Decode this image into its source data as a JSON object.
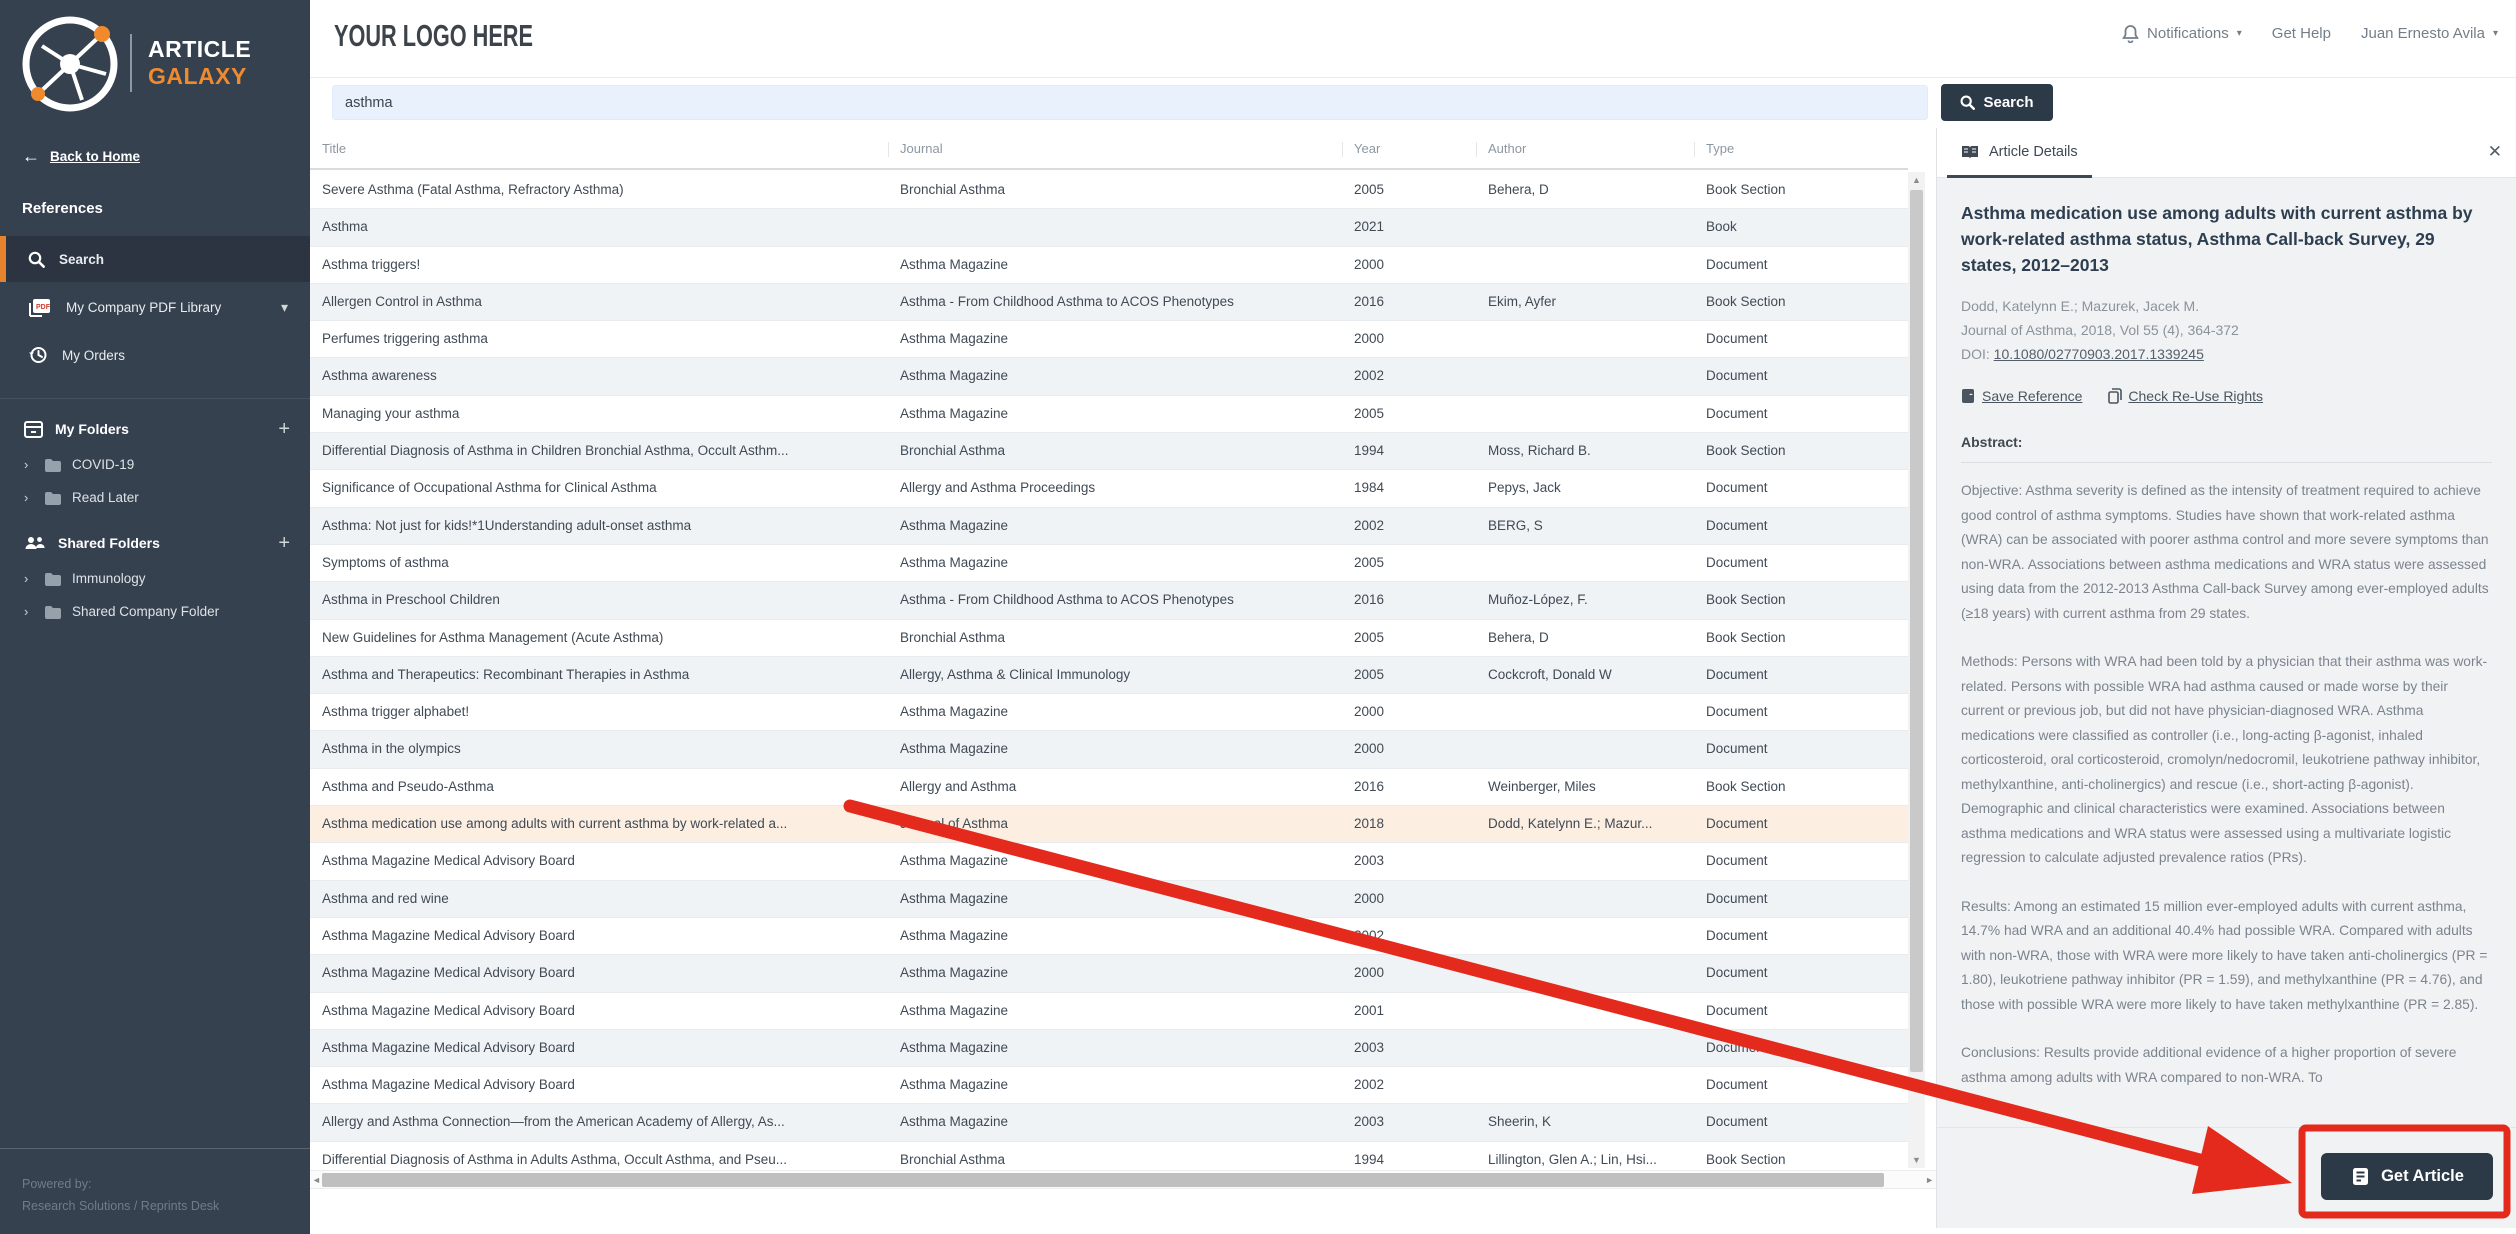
{
  "icons": {
    "chevron_right": "›",
    "caret_down": "▾",
    "plus": "+",
    "back_arrow": "←",
    "close": "✕",
    "up": "▲",
    "down": "▼",
    "left": "◄",
    "right": "►"
  },
  "app": {
    "brand_line1": "ARTICLE",
    "brand_line2": "GALAXY",
    "customer_logo": "YOUR LOGO HERE",
    "powered_by_label": "Powered by:",
    "powered_by_value": "Research Solutions / Reprints Desk"
  },
  "header": {
    "notifications_label": "Notifications",
    "get_help_label": "Get Help",
    "user_name": "Juan Ernesto Avila"
  },
  "search": {
    "query": "asthma",
    "button_label": "Search"
  },
  "sidebar": {
    "back_to_home": "Back to Home",
    "section_references": "References",
    "items": [
      {
        "label": "Search"
      },
      {
        "label": "My Company PDF Library"
      },
      {
        "label": "My Orders"
      }
    ],
    "my_folders_label": "My Folders",
    "my_folders": [
      "COVID-19",
      "Read Later"
    ],
    "shared_folders_label": "Shared Folders",
    "shared_folders": [
      "Immunology",
      "Shared Company Folder"
    ]
  },
  "table": {
    "columns": [
      "Title",
      "Journal",
      "Year",
      "Author",
      "Type"
    ],
    "rows": [
      {
        "title": "Severe Asthma (Fatal Asthma, Refractory Asthma)",
        "journal": "Bronchial Asthma",
        "year": "2005",
        "author": "Behera, D",
        "type": "Book Section"
      },
      {
        "title": "Asthma",
        "journal": "",
        "year": "2021",
        "author": "",
        "type": "Book"
      },
      {
        "title": "Asthma triggers!",
        "journal": "Asthma Magazine",
        "year": "2000",
        "author": "",
        "type": "Document"
      },
      {
        "title": "Allergen Control in Asthma",
        "journal": "Asthma - From Childhood Asthma to ACOS Phenotypes",
        "year": "2016",
        "author": "Ekim, Ayfer",
        "type": "Book Section"
      },
      {
        "title": "Perfumes triggering asthma",
        "journal": "Asthma Magazine",
        "year": "2000",
        "author": "",
        "type": "Document"
      },
      {
        "title": "Asthma awareness",
        "journal": "Asthma Magazine",
        "year": "2002",
        "author": "",
        "type": "Document"
      },
      {
        "title": "Managing your asthma",
        "journal": "Asthma Magazine",
        "year": "2005",
        "author": "",
        "type": "Document"
      },
      {
        "title": "Differential Diagnosis of Asthma in Children Bronchial Asthma, Occult Asthm...",
        "journal": "Bronchial Asthma",
        "year": "1994",
        "author": "Moss, Richard B.",
        "type": "Book Section"
      },
      {
        "title": "Significance of Occupational Asthma for Clinical Asthma",
        "journal": "Allergy and Asthma Proceedings",
        "year": "1984",
        "author": "Pepys, Jack",
        "type": "Document"
      },
      {
        "title": "Asthma: Not just for kids!*1Understanding adult-onset asthma",
        "journal": "Asthma Magazine",
        "year": "2002",
        "author": "BERG, S",
        "type": "Document"
      },
      {
        "title": "Symptoms of asthma",
        "journal": "Asthma Magazine",
        "year": "2005",
        "author": "",
        "type": "Document"
      },
      {
        "title": "Asthma in Preschool Children",
        "journal": "Asthma - From Childhood Asthma to ACOS Phenotypes",
        "year": "2016",
        "author": "Muñoz-López, F.",
        "type": "Book Section"
      },
      {
        "title": "New Guidelines for Asthma Management (Acute Asthma)",
        "journal": "Bronchial Asthma",
        "year": "2005",
        "author": "Behera, D",
        "type": "Book Section"
      },
      {
        "title": "Asthma and Therapeutics: Recombinant Therapies in Asthma",
        "journal": "Allergy, Asthma & Clinical Immunology",
        "year": "2005",
        "author": "Cockcroft, Donald W",
        "type": "Document"
      },
      {
        "title": "Asthma trigger alphabet!",
        "journal": "Asthma Magazine",
        "year": "2000",
        "author": "",
        "type": "Document"
      },
      {
        "title": "Asthma in the olympics",
        "journal": "Asthma Magazine",
        "year": "2000",
        "author": "",
        "type": "Document"
      },
      {
        "title": "Asthma and Pseudo-Asthma",
        "journal": "Allergy and Asthma",
        "year": "2016",
        "author": "Weinberger, Miles",
        "type": "Book Section"
      },
      {
        "title": "Asthma medication use among adults with current asthma by work-related a...",
        "journal": "Journal of Asthma",
        "year": "2018",
        "author": "Dodd, Katelynn E.; Mazur...",
        "type": "Document",
        "selected": true
      },
      {
        "title": "Asthma Magazine Medical Advisory Board",
        "journal": "Asthma Magazine",
        "year": "2003",
        "author": "",
        "type": "Document"
      },
      {
        "title": "Asthma and red wine",
        "journal": "Asthma Magazine",
        "year": "2000",
        "author": "",
        "type": "Document"
      },
      {
        "title": "Asthma Magazine Medical Advisory Board",
        "journal": "Asthma Magazine",
        "year": "2002",
        "author": "",
        "type": "Document"
      },
      {
        "title": "Asthma Magazine Medical Advisory Board",
        "journal": "Asthma Magazine",
        "year": "2000",
        "author": "",
        "type": "Document"
      },
      {
        "title": "Asthma Magazine Medical Advisory Board",
        "journal": "Asthma Magazine",
        "year": "2001",
        "author": "",
        "type": "Document"
      },
      {
        "title": "Asthma Magazine Medical Advisory Board",
        "journal": "Asthma Magazine",
        "year": "2003",
        "author": "",
        "type": "Document"
      },
      {
        "title": "Asthma Magazine Medical Advisory Board",
        "journal": "Asthma Magazine",
        "year": "2002",
        "author": "",
        "type": "Document"
      },
      {
        "title": "Allergy and Asthma Connection—from the American Academy of Allergy, As...",
        "journal": "Asthma Magazine",
        "year": "2003",
        "author": "Sheerin, K",
        "type": "Document"
      },
      {
        "title": "Differential Diagnosis of Asthma in Adults Asthma, Occult Asthma, and Pseu...",
        "journal": "Bronchial Asthma",
        "year": "1994",
        "author": "Lillington, Glen A.; Lin, Hsi...",
        "type": "Book Section"
      }
    ]
  },
  "panel": {
    "tab_label": "Article Details",
    "title": "Asthma medication use among adults with current asthma by work-related asthma status, Asthma Call-back Survey, 29 states, 2012–2013",
    "authors": "Dodd, Katelynn E.; Mazurek, Jacek M.",
    "source": "Journal of Asthma, 2018, Vol 55 (4), 364-372",
    "doi_label": "DOI: ",
    "doi": "10.1080/02770903.2017.1339245",
    "save_reference_label": "Save Reference",
    "check_rights_label": "Check Re-Use Rights",
    "abstract_label": "Abstract:",
    "abstract_paragraphs": [
      "Objective: Asthma severity is defined as the intensity of treatment required to achieve good control of asthma symptoms. Studies have shown that work-related asthma (WRA) can be associated with poorer asthma control and more severe symptoms than non-WRA. Associations between asthma medications and WRA status were assessed using data from the 2012-2013 Asthma Call-back Survey among ever-employed adults (≥18 years) with current asthma from 29 states.",
      "Methods: Persons with WRA had been told by a physician that their asthma was work-related. Persons with possible WRA had asthma caused or made worse by their current or previous job, but did not have physician-diagnosed WRA. Asthma medications were classified as controller (i.e., long-acting β-agonist, inhaled corticosteroid, oral corticosteroid, cromolyn/nedocromil, leukotriene pathway inhibitor, methylxanthine, anti-cholinergics) and rescue (i.e., short-acting β-agonist). Demographic and clinical characteristics were examined. Associations between asthma medications and WRA status were assessed using a multivariate logistic regression to calculate adjusted prevalence ratios (PRs).",
      "Results: Among an estimated 15 million ever-employed adults with current asthma, 14.7% had WRA and an additional 40.4% had possible WRA. Compared with adults with non-WRA, those with WRA were more likely to have taken anti-cholinergics (PR = 1.80), leukotriene pathway inhibitor (PR = 1.59), and methylxanthine (PR = 4.76), and those with possible WRA were more likely to have taken methylxanthine (PR = 2.85).",
      "Conclusions: Results provide additional evidence of a higher proportion of severe asthma among adults with WRA compared to non-WRA. To"
    ],
    "get_article_label": "Get Article"
  },
  "colors": {
    "sidebar_bg": "#36414f",
    "accent_orange": "#e5832e",
    "brand_orange": "#f08a2d",
    "dark_button": "#2c3947",
    "selected_row": "#fcefe2",
    "annotation_red": "#e32a1d",
    "search_input_bg": "#e9f1fc"
  }
}
